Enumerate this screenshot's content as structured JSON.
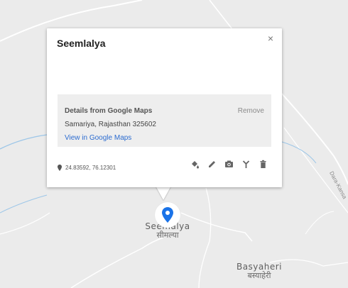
{
  "popup": {
    "title": "Seemlalya",
    "close_label": "×",
    "details": {
      "heading": "Details from Google Maps",
      "remove_label": "Remove",
      "address": "Samariya, Rajasthan 325602",
      "link_label": "View in Google Maps"
    },
    "coordinates": "24.83592, 76.12301",
    "tools": [
      "paint-bucket-icon",
      "pencil-icon",
      "camera-icon",
      "directions-fork-icon",
      "trash-icon"
    ]
  },
  "map": {
    "place_label_en": "Seemalya",
    "place_label_hi": "सीमल्या",
    "village_label_en": "Basyaheri",
    "village_label_hi": "बस्याहेरी",
    "road_label": "Dara-Kansa"
  },
  "colors": {
    "map_bg": "#ebebeb",
    "road": "#ffffff",
    "stream": "#9cc6e8",
    "marker": "#1a73e8",
    "link": "#2c6cd0"
  }
}
